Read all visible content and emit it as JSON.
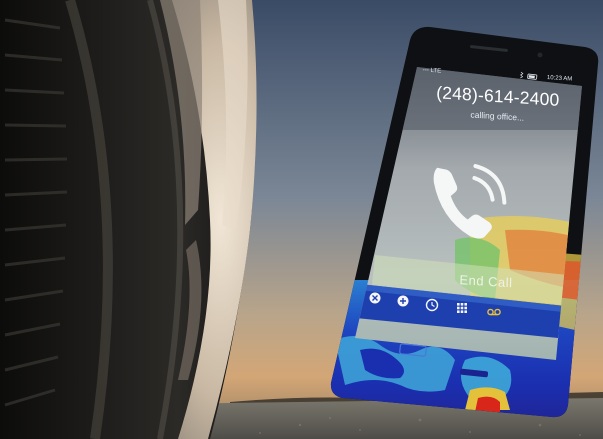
{
  "phone": {
    "status": {
      "left": "◦◦◦ LTE",
      "right": "10:23 AM"
    },
    "call_number": "(248)-614-2400",
    "call_status": "calling office...",
    "end_call_label": "End Call"
  },
  "colors": {
    "sky_top": "#3d4f6b",
    "sky_bottom": "#c9a47a",
    "road": "#6a6860",
    "tire": "#1b1a18",
    "phone_frame": "#0d0f12",
    "heat_low": "#1a2fb0",
    "heat_mid": "#3fa8d8",
    "heat_high": "#d8261a"
  },
  "icons": {
    "tray": [
      "close-circle-icon",
      "add-circle-icon",
      "clock-icon",
      "keypad-icon",
      "voicemail-icon"
    ],
    "hero": "phone-handset-icon"
  }
}
